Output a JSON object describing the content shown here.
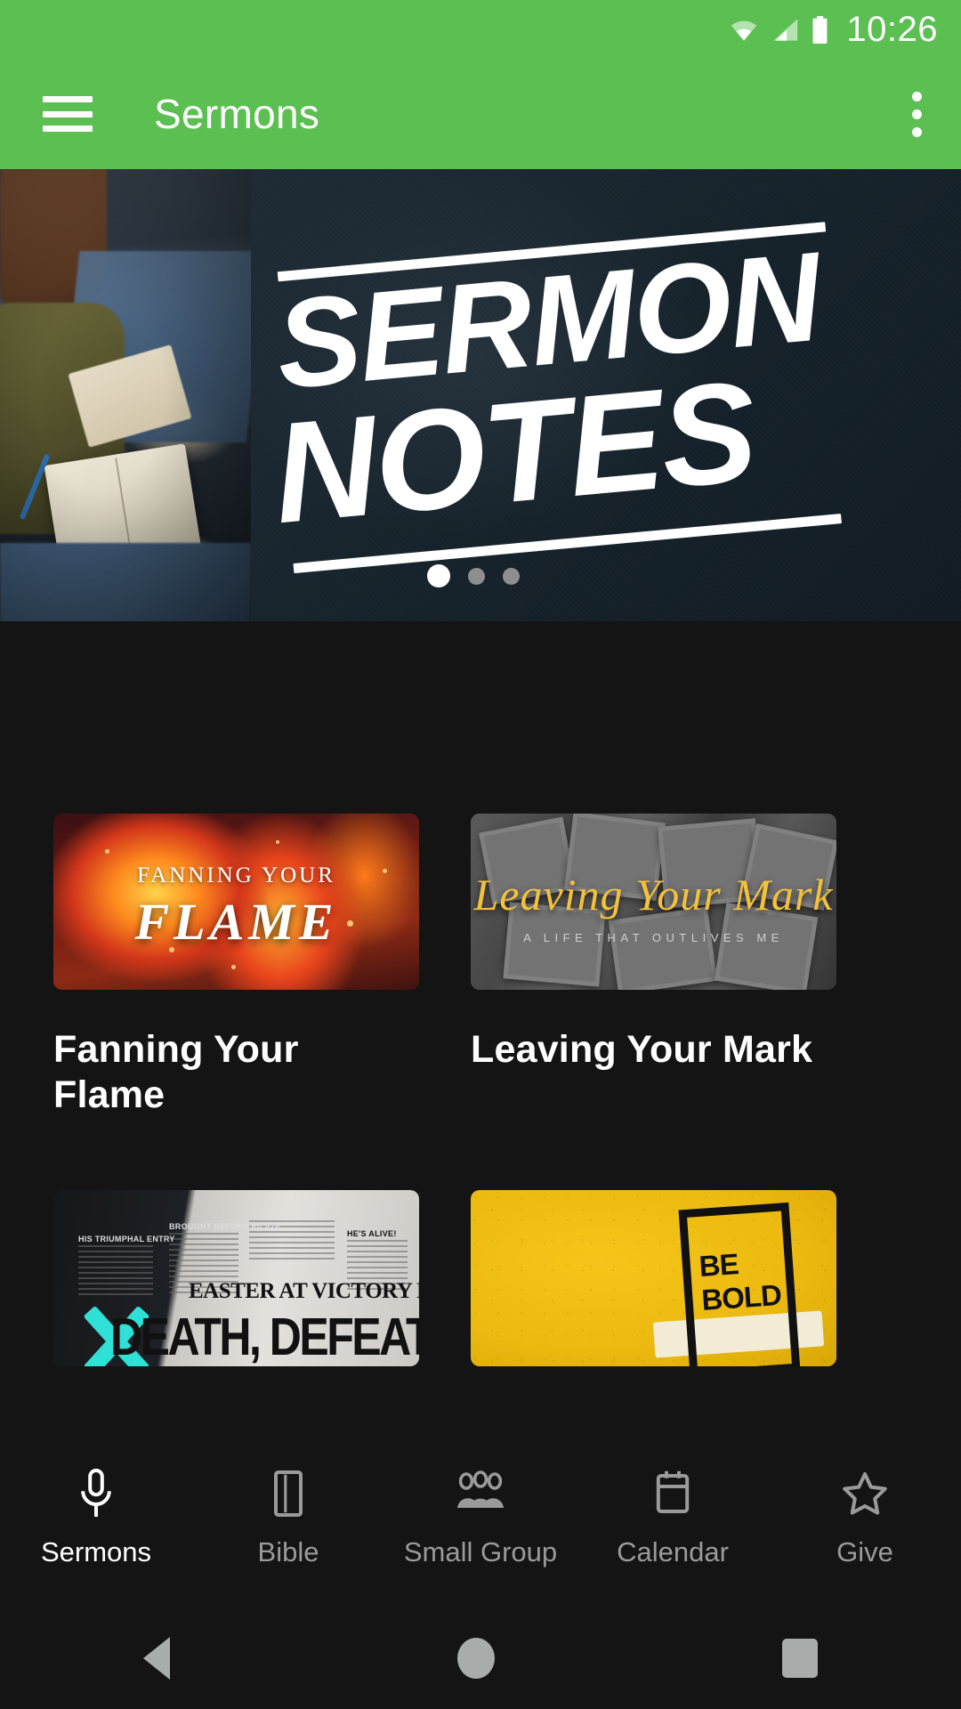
{
  "statusbar": {
    "time": "10:26",
    "icons": [
      "wifi-icon",
      "cellular-signal-icon",
      "battery-icon"
    ]
  },
  "appbar": {
    "menu_icon": "hamburger-menu-icon",
    "title": "Sermons",
    "overflow_icon": "more-vertical-icon",
    "background_color": "#5BBF52"
  },
  "hero": {
    "title_line1": "SERMON",
    "title_line2": "NOTES",
    "slide_count": 3,
    "active_slide": 1,
    "background_color": "#16222B"
  },
  "cards": [
    {
      "title": "Fanning Your Flame",
      "art_sub": "FANNING YOUR",
      "art_main": "FLAME"
    },
    {
      "title": "Leaving Your Mark",
      "art_main": "Leaving Your Mark",
      "art_sub": "A LIFE THAT OUTLIVES ME",
      "accent_color": "#F2C13D"
    },
    {
      "title": "",
      "art_kicker": "EASTER AT VICTORY HILL",
      "art_main": "DEATH, DEFEATED",
      "art_cols": [
        "HIS TRIUMPHAL ENTRY",
        "BROUGHT BEFORE PILATE",
        "HE'S ALIVE!"
      ],
      "accent_color": "#2FE0D6"
    },
    {
      "title": "",
      "art_main_line1": "BE",
      "art_main_line2": "BOLD",
      "background_color": "#F5C518"
    }
  ],
  "bottomnav": {
    "items": [
      {
        "label": "Sermons",
        "icon": "microphone-icon",
        "active": true
      },
      {
        "label": "Bible",
        "icon": "book-icon",
        "active": false
      },
      {
        "label": "Small Group",
        "icon": "people-group-icon",
        "active": false
      },
      {
        "label": "Calendar",
        "icon": "calendar-icon",
        "active": false
      },
      {
        "label": "Give",
        "icon": "star-icon",
        "active": false
      }
    ]
  },
  "sysnav": {
    "back": "back-triangle-icon",
    "home": "home-circle-icon",
    "recents": "recents-square-icon"
  }
}
